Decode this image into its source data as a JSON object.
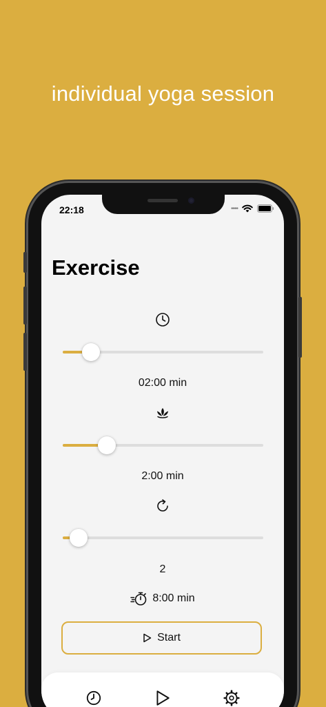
{
  "headline": "individual yoga session",
  "status": {
    "time": "22:18"
  },
  "screen_title": "Exercise",
  "sliders": [
    {
      "icon": "clock-icon",
      "value_label": "02:00 min",
      "level": 0.14
    },
    {
      "icon": "lotus-icon",
      "value_label": "2:00 min",
      "level": 0.22
    },
    {
      "icon": "repeat-icon",
      "value_label": "2",
      "level": 0.08
    }
  ],
  "total": {
    "icon": "stopwatch-icon",
    "label": "8:00 min"
  },
  "start_button": {
    "label": "Start",
    "icon": "play-icon"
  },
  "tabs": [
    {
      "icon": "clock-icon",
      "name": "history"
    },
    {
      "icon": "play-icon",
      "name": "session"
    },
    {
      "icon": "gear-icon",
      "name": "settings"
    }
  ],
  "colors": {
    "accent": "#dbae40",
    "background": "#f4f4f4"
  }
}
